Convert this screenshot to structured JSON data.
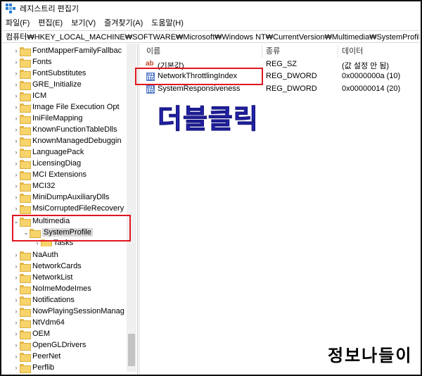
{
  "window": {
    "title": "레지스트리 편집기"
  },
  "menu": [
    "파일(F)",
    "편집(E)",
    "보기(V)",
    "즐겨찾기(A)",
    "도움말(H)"
  ],
  "address": "컴퓨터₩HKEY_LOCAL_MACHINE₩SOFTWARE₩Microsoft₩Windows NT₩CurrentVersion₩Multimedia₩SystemProfile",
  "tree": [
    {
      "label": "FontMapperFamilyFallbac",
      "expanded": false
    },
    {
      "label": "Fonts",
      "expanded": false
    },
    {
      "label": "FontSubstitutes",
      "expanded": false
    },
    {
      "label": "GRE_Initialize",
      "expanded": false
    },
    {
      "label": "ICM",
      "expanded": false
    },
    {
      "label": "Image File Execution Opt",
      "expanded": false
    },
    {
      "label": "IniFileMapping",
      "expanded": false
    },
    {
      "label": "KnownFunctionTableDlls",
      "expanded": false
    },
    {
      "label": "KnownManagedDebuggin",
      "expanded": false
    },
    {
      "label": "LanguagePack",
      "expanded": false
    },
    {
      "label": "LicensingDiag",
      "expanded": false
    },
    {
      "label": "MCI Extensions",
      "expanded": false
    },
    {
      "label": "MCI32",
      "expanded": false
    },
    {
      "label": "MiniDumpAuxiliaryDlls",
      "expanded": false
    },
    {
      "label": "MsiCorruptedFileRecovery",
      "expanded": false
    },
    {
      "label": "Multimedia",
      "expanded": true
    },
    {
      "label": "SystemProfile",
      "expanded": true,
      "selected": true
    },
    {
      "label": "Tasks",
      "expanded": false
    },
    {
      "label": "NaAuth",
      "expanded": false
    },
    {
      "label": "NetworkCards",
      "expanded": false
    },
    {
      "label": "NetworkList",
      "expanded": false
    },
    {
      "label": "NoImeModeImes",
      "expanded": false
    },
    {
      "label": "Notifications",
      "expanded": false
    },
    {
      "label": "NowPlayingSessionManag",
      "expanded": false
    },
    {
      "label": "NtVdm64",
      "expanded": false
    },
    {
      "label": "OEM",
      "expanded": false
    },
    {
      "label": "OpenGLDrivers",
      "expanded": false
    },
    {
      "label": "PeerNet",
      "expanded": false
    },
    {
      "label": "Perflib",
      "expanded": false
    }
  ],
  "columns": {
    "name": "이름",
    "type": "종류",
    "data": "데이터"
  },
  "values": [
    {
      "name": "(기본값)",
      "type": "REG_SZ",
      "data": "(값 설정 안 됨)",
      "icon": "string-value-icon"
    },
    {
      "name": "NetworkThrottlingIndex",
      "type": "REG_DWORD",
      "data": "0x0000000a (10)",
      "icon": "dword-value-icon"
    },
    {
      "name": "SystemResponsiveness",
      "type": "REG_DWORD",
      "data": "0x00000014 (20)",
      "icon": "dword-value-icon"
    }
  ],
  "annotation": "더블클릭",
  "watermark": "정보나들이",
  "colors": {
    "highlight": "#e0161f",
    "annotation": "#2b2bd6"
  }
}
